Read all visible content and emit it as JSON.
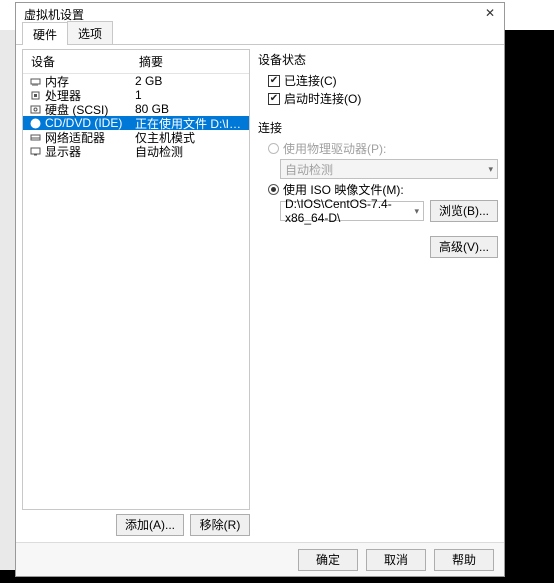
{
  "window": {
    "title": "虚拟机设置"
  },
  "tabs": {
    "hardware": "硬件",
    "options": "选项"
  },
  "hw_table": {
    "header_device": "设备",
    "header_summary": "摘要",
    "rows": [
      {
        "icon": "memory",
        "device": "内存",
        "summary": "2 GB"
      },
      {
        "icon": "cpu",
        "device": "处理器",
        "summary": "1"
      },
      {
        "icon": "disk",
        "device": "硬盘 (SCSI)",
        "summary": "80 GB"
      },
      {
        "icon": "cd",
        "device": "CD/DVD (IDE)",
        "summary": "正在使用文件 D:\\IOS\\CentO..."
      },
      {
        "icon": "net",
        "device": "网络适配器",
        "summary": "仅主机模式"
      },
      {
        "icon": "display",
        "device": "显示器",
        "summary": "自动检测"
      }
    ]
  },
  "left_buttons": {
    "add": "添加(A)...",
    "remove": "移除(R)"
  },
  "right": {
    "status_title": "设备状态",
    "connected": "已连接(C)",
    "connect_at_power_on": "启动时连接(O)",
    "connection_title": "连接",
    "use_physical": "使用物理驱动器(P):",
    "auto_detect": "自动检测",
    "use_iso": "使用 ISO 映像文件(M):",
    "iso_path": "D:\\IOS\\CentOS-7.4-x86_64-D\\",
    "browse": "浏览(B)...",
    "advanced": "高级(V)..."
  },
  "footer": {
    "ok": "确定",
    "cancel": "取消",
    "help": "帮助"
  }
}
